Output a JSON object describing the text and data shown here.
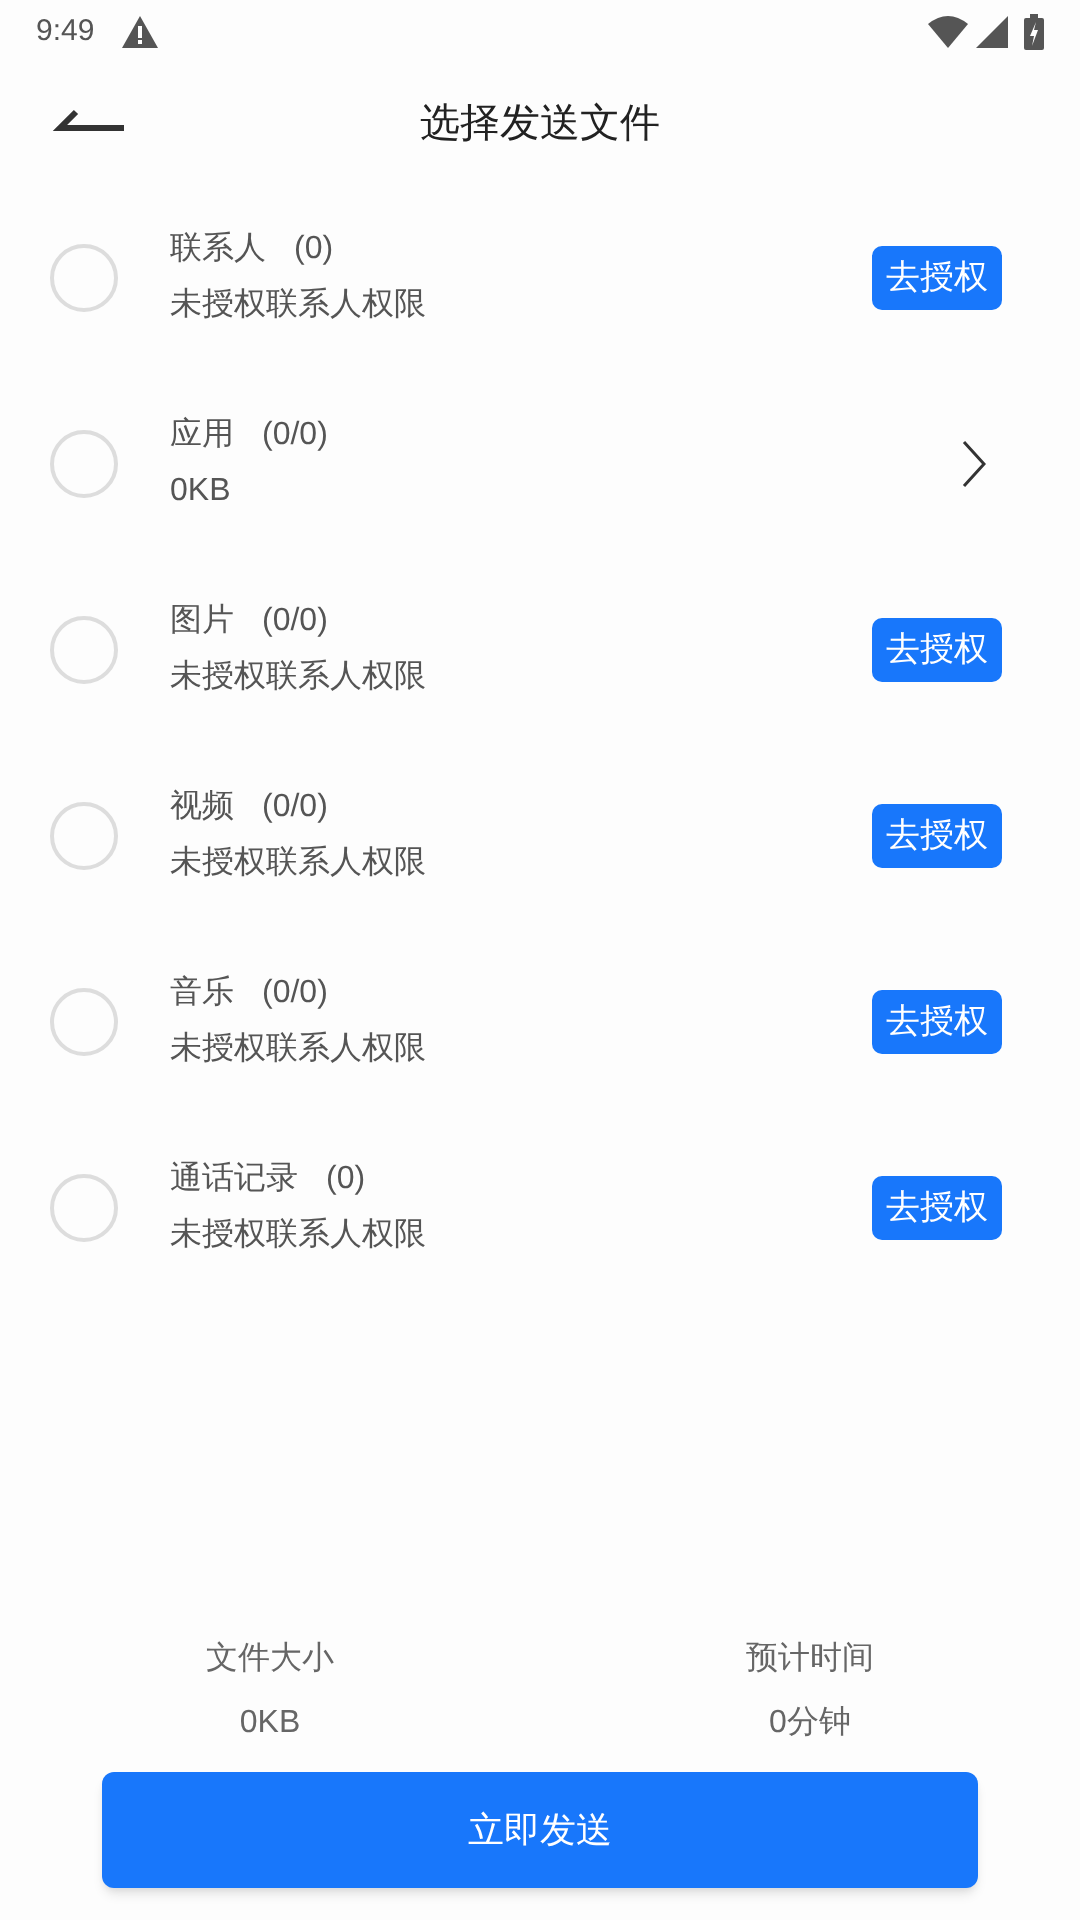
{
  "status_bar": {
    "time": "9:49"
  },
  "header": {
    "title": "选择发送文件"
  },
  "items": [
    {
      "title": "联系人",
      "count": "(0)",
      "subtitle": "未授权联系人权限",
      "checked": false,
      "kind": "button",
      "action": "去授权"
    },
    {
      "title": "应用",
      "count": "(0/0)",
      "subtitle": "0KB",
      "checked": false,
      "kind": "chevron"
    },
    {
      "title": "图片",
      "count": "(0/0)",
      "subtitle": "未授权联系人权限",
      "checked": false,
      "kind": "button",
      "action": "去授权"
    },
    {
      "title": "视频",
      "count": "(0/0)",
      "subtitle": "未授权联系人权限",
      "checked": false,
      "kind": "button",
      "action": "去授权"
    },
    {
      "title": "音乐",
      "count": "(0/0)",
      "subtitle": "未授权联系人权限",
      "checked": false,
      "kind": "button",
      "action": "去授权"
    },
    {
      "title": "通话记录",
      "count": "(0)",
      "subtitle": "未授权联系人权限",
      "checked": false,
      "kind": "button",
      "action": "去授权"
    }
  ],
  "summary": [
    {
      "label": "文件大小",
      "value": "0KB"
    },
    {
      "label": "预计时间",
      "value": "0分钟"
    }
  ],
  "send_button": "立即发送"
}
